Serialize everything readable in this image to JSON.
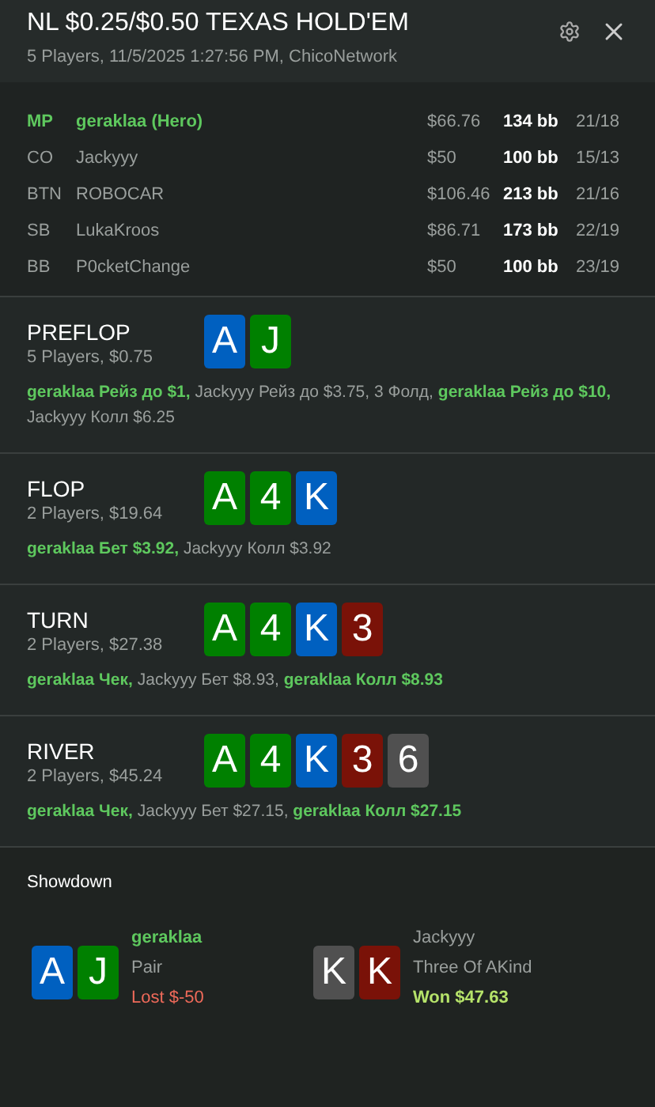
{
  "header": {
    "title": "NL $0.25/$0.50 TEXAS HOLD'EM",
    "subtitle": "5 Players, 11/5/2025 1:27:56 PM, ChicoNetwork"
  },
  "players": [
    {
      "position": "MP",
      "name": "geraklaa (Hero)",
      "hero": true,
      "stack": "$66.76",
      "bb": "134 bb",
      "stats": "21/18"
    },
    {
      "position": "CO",
      "name": "Jackyyy",
      "hero": false,
      "stack": "$50",
      "bb": "100 bb",
      "stats": "15/13"
    },
    {
      "position": "BTN",
      "name": "ROBOCAR",
      "hero": false,
      "stack": "$106.46",
      "bb": "213 bb",
      "stats": "21/16"
    },
    {
      "position": "SB",
      "name": "LukaKroos",
      "hero": false,
      "stack": "$86.71",
      "bb": "173 bb",
      "stats": "22/19"
    },
    {
      "position": "BB",
      "name": "P0cketChange",
      "hero": false,
      "stack": "$50",
      "bb": "100 bb",
      "stats": "23/19"
    }
  ],
  "streets": [
    {
      "name": "PREFLOP",
      "info": "5 Players, $0.75",
      "cards": [
        {
          "rank": "A",
          "color": "#0060c0"
        },
        {
          "rank": "J",
          "color": "#008000"
        }
      ],
      "actions": [
        {
          "text": "geraklaa Рейз до $1,",
          "hero": true
        },
        {
          "text": "Jackyyy Рейз до $3.75, 3 Фолд,",
          "hero": false
        },
        {
          "text": "geraklaa Рейз до $10,",
          "hero": true
        },
        {
          "text": "Jackyyy Колл $6.25",
          "hero": false
        }
      ]
    },
    {
      "name": "FLOP",
      "info": "2 Players, $19.64",
      "cards": [
        {
          "rank": "A",
          "color": "#008000"
        },
        {
          "rank": "4",
          "color": "#008000"
        },
        {
          "rank": "K",
          "color": "#0060c0"
        }
      ],
      "actions": [
        {
          "text": "geraklaa Бет $3.92,",
          "hero": true
        },
        {
          "text": "Jackyyy Колл $3.92",
          "hero": false
        }
      ]
    },
    {
      "name": "TURN",
      "info": "2 Players, $27.38",
      "cards": [
        {
          "rank": "A",
          "color": "#008000"
        },
        {
          "rank": "4",
          "color": "#008000"
        },
        {
          "rank": "K",
          "color": "#0060c0"
        },
        {
          "rank": "3",
          "color": "#7a1208"
        }
      ],
      "actions": [
        {
          "text": "geraklaa Чек,",
          "hero": true
        },
        {
          "text": "Jackyyy Бет $8.93,",
          "hero": false
        },
        {
          "text": "geraklaa Колл $8.93",
          "hero": true
        }
      ]
    },
    {
      "name": "RIVER",
      "info": "2 Players, $45.24",
      "cards": [
        {
          "rank": "A",
          "color": "#008000"
        },
        {
          "rank": "4",
          "color": "#008000"
        },
        {
          "rank": "K",
          "color": "#0060c0"
        },
        {
          "rank": "3",
          "color": "#7a1208"
        },
        {
          "rank": "6",
          "color": "#505050"
        }
      ],
      "actions": [
        {
          "text": "geraklaa Чек,",
          "hero": true
        },
        {
          "text": "Jackyyy Бет $27.15,",
          "hero": false
        },
        {
          "text": "geraklaa Колл $27.15",
          "hero": true
        }
      ]
    }
  ],
  "showdown": {
    "title": "Showdown",
    "hands": [
      {
        "player": "geraklaa",
        "hero": true,
        "cards": [
          {
            "rank": "A",
            "color": "#0060c0"
          },
          {
            "rank": "J",
            "color": "#008000"
          }
        ],
        "hand": "Pair",
        "result": "Lost $-50",
        "kind": "lost"
      },
      {
        "player": "Jackyyy",
        "hero": false,
        "cards": [
          {
            "rank": "K",
            "color": "#505050"
          },
          {
            "rank": "K",
            "color": "#7a1208"
          }
        ],
        "hand": "Three Of AKind",
        "result": "Won $47.63",
        "kind": "won"
      }
    ]
  }
}
